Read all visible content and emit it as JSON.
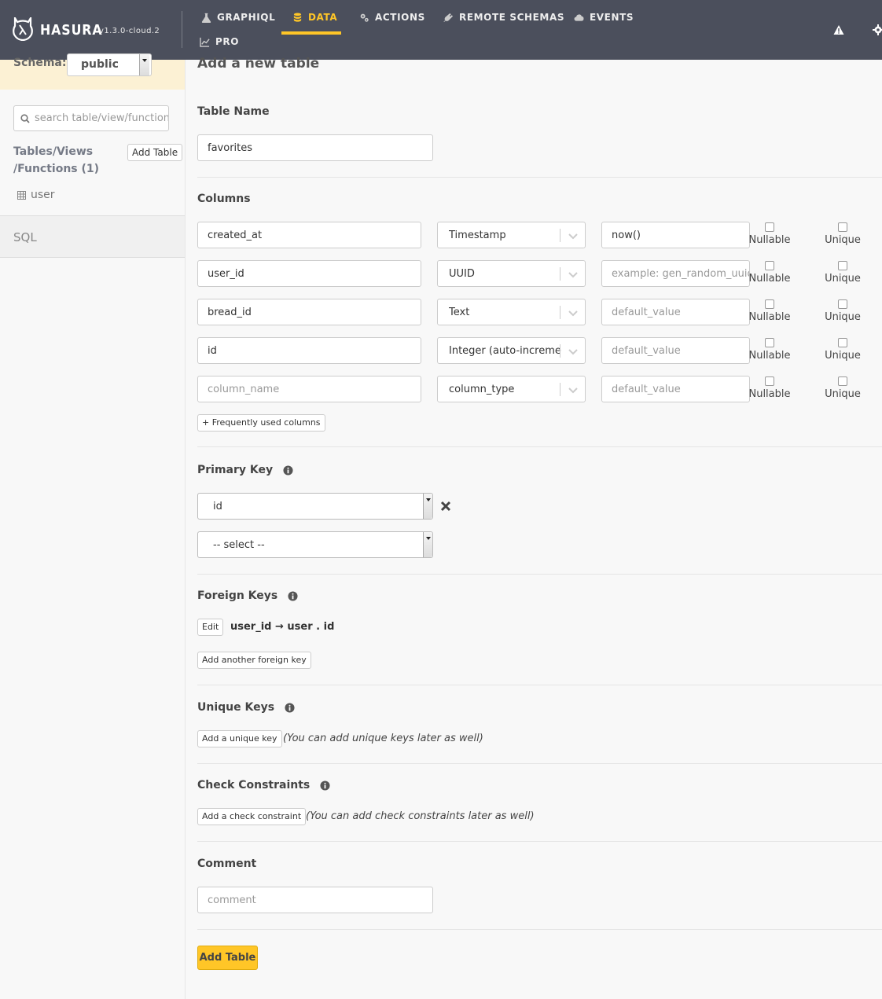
{
  "header": {
    "brand": "HASURA",
    "version": "v1.3.0-cloud.2",
    "nav": [
      {
        "label": "GRAPHIQL",
        "icon": "flask-icon"
      },
      {
        "label": "DATA",
        "icon": "database-icon"
      },
      {
        "label": "ACTIONS",
        "icon": "cogs-icon"
      },
      {
        "label": "REMOTE SCHEMAS",
        "icon": "plug-icon"
      },
      {
        "label": "EVENTS",
        "icon": "cloud-icon"
      },
      {
        "label": "PRO",
        "icon": "chart-line-icon"
      }
    ],
    "active_tab": "DATA"
  },
  "sidebar": {
    "schema_label": "Schema:",
    "schema_value": "public",
    "search_placeholder": "search table/view/function",
    "tables_heading_line1": "Tables/Views",
    "tables_heading_line2": "/Functions (1)",
    "add_table_label": "Add Table",
    "tables": [
      "user"
    ],
    "sql_label": "SQL"
  },
  "main": {
    "title": "Add a new table",
    "table_name_heading": "Table Name",
    "table_name_value": "favorites",
    "columns_heading": "Columns",
    "columns": [
      {
        "name": "created_at",
        "type": "Timestamp",
        "default": "now()",
        "default_is_placeholder": false
      },
      {
        "name": "user_id",
        "type": "UUID",
        "default": "example: gen_random_uuid()",
        "default_is_placeholder": true
      },
      {
        "name": "bread_id",
        "type": "Text",
        "default": "default_value",
        "default_is_placeholder": true
      },
      {
        "name": "id",
        "type": "Integer (auto-increment)",
        "default": "default_value",
        "default_is_placeholder": true
      },
      {
        "name": "column_name",
        "type": "column_type",
        "default": "default_value",
        "default_is_placeholder": true
      }
    ],
    "nullable_label": "Nullable",
    "unique_label": "Unique",
    "frequent_columns_label": "+ Frequently used columns",
    "primary_key_heading": "Primary Key",
    "primary_keys": [
      "id",
      "-- select --"
    ],
    "foreign_keys_heading": "Foreign Keys",
    "fk_edit_label": "Edit",
    "fk_text": "user_id → user . id",
    "add_fk_label": "Add another foreign key",
    "unique_keys_heading": "Unique Keys",
    "add_unique_label": "Add a unique key",
    "unique_note": "(You can add unique keys later as well)",
    "check_heading": "Check Constraints",
    "add_check_label": "Add a check constraint",
    "check_note": "(You can add check constraints later as well)",
    "comment_heading": "Comment",
    "comment_placeholder": "comment",
    "submit_label": "Add Table"
  },
  "colors": {
    "nav_bg": "#4b4f5c",
    "accent": "#ffc627",
    "schema_bg": "#fcf1d4"
  }
}
